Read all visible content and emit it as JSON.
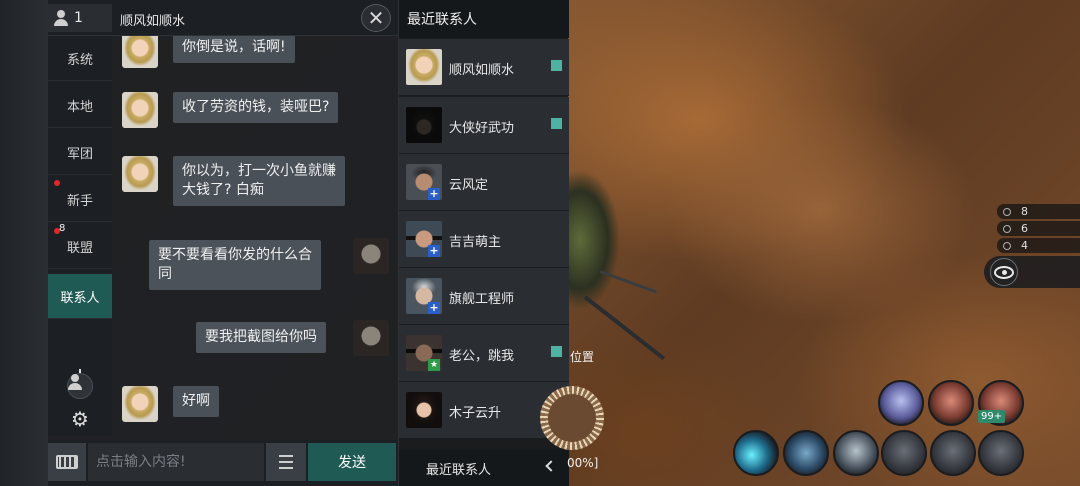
{
  "header": {
    "member_count": "1",
    "chat_title": "顺风如顺水",
    "close_symbol": "✕"
  },
  "channels": [
    {
      "label": "系统"
    },
    {
      "label": "本地"
    },
    {
      "label": "军团"
    },
    {
      "label": "新手"
    },
    {
      "label": "联盟",
      "badge": "8"
    },
    {
      "label": "联系人"
    }
  ],
  "messages": [
    {
      "sender": "other",
      "text": "你倒是说，话啊!"
    },
    {
      "sender": "other",
      "text": "收了劳资的钱，装哑巴?"
    },
    {
      "sender": "other",
      "text_line1": "你以为，打一次小鱼就赚",
      "text_line2": "大钱了? 白痴"
    },
    {
      "sender": "self",
      "text_line1": "要不要看看你发的什么合",
      "text_line2": "同"
    },
    {
      "sender": "self",
      "text": "要我把截图给你吗"
    },
    {
      "sender": "other",
      "text": "好啊"
    }
  ],
  "input": {
    "placeholder": "点击输入内容!",
    "send_label": "发送"
  },
  "contacts": {
    "header": "最近联系人",
    "items": [
      {
        "name": "顺风如顺水",
        "online": true
      },
      {
        "name": "大侠好武功",
        "online": true
      },
      {
        "name": "云风定",
        "online": false,
        "badge": "+"
      },
      {
        "name": "吉吉萌主",
        "online": false,
        "badge": "+"
      },
      {
        "name": "旗舰工程师",
        "online": false,
        "badge": "+"
      },
      {
        "name": "老公，跳我",
        "online": true,
        "badge": "★"
      },
      {
        "name": "木子云升",
        "online": false
      }
    ],
    "footer": "最近联系人"
  },
  "hud": {
    "stats": [
      "8",
      "6",
      "4"
    ],
    "position_label": "位置",
    "percent_label": "00%]",
    "module_badge": "99+"
  },
  "colors": {
    "accent": "#1f5a55",
    "online": "#4fb3a3",
    "alert": "#e0282a"
  }
}
